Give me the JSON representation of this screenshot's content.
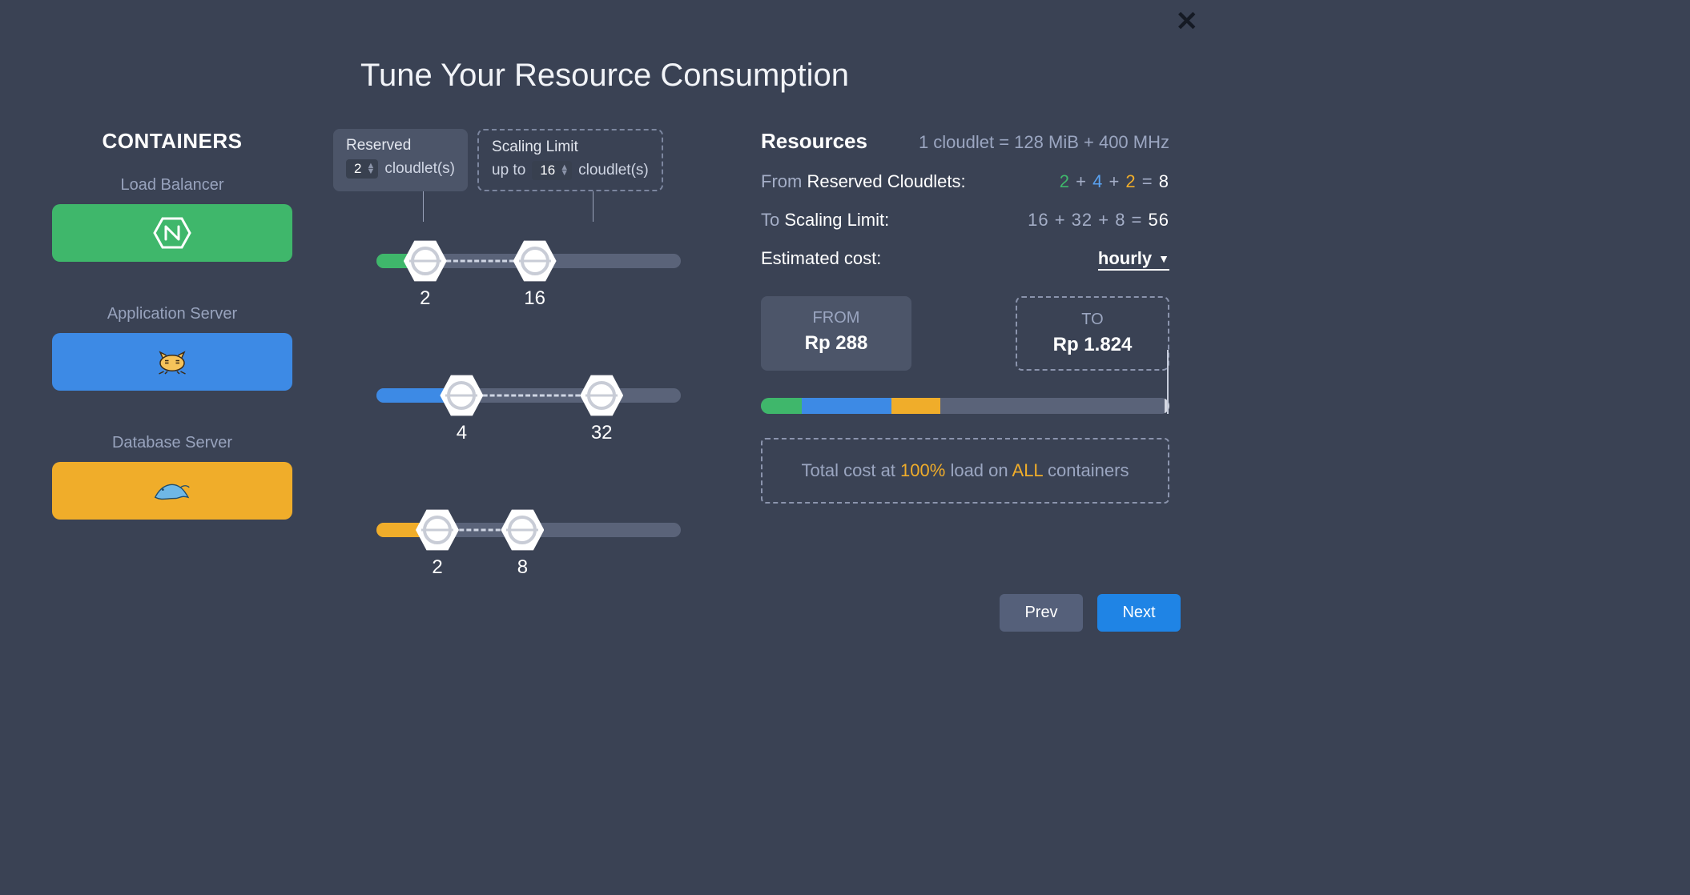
{
  "title": "Tune Your Resource Consumption",
  "close_label": "✕",
  "containers": {
    "heading": "CONTAINERS",
    "items": [
      {
        "label": "Load Balancer",
        "icon": "nginx-icon",
        "color": "green"
      },
      {
        "label": "Application Server",
        "icon": "tomcat-icon",
        "color": "blue"
      },
      {
        "label": "Database Server",
        "icon": "mysql-icon",
        "color": "orange"
      }
    ]
  },
  "tooltips": {
    "reserved": {
      "title": "Reserved",
      "value": "2",
      "unit": "cloudlet(s)"
    },
    "scaling": {
      "title": "Scaling Limit",
      "prefix": "up to",
      "value": "16",
      "unit": "cloudlet(s)"
    }
  },
  "sliders": [
    {
      "reserved": 2,
      "limit": 16,
      "reserved_pct": 16,
      "limit_pct": 52,
      "color": "#3fb76b"
    },
    {
      "reserved": 4,
      "limit": 32,
      "reserved_pct": 28,
      "limit_pct": 74,
      "color": "#3d8ae5"
    },
    {
      "reserved": 2,
      "limit": 8,
      "reserved_pct": 20,
      "limit_pct": 48,
      "color": "#f0ad2a"
    }
  ],
  "resources": {
    "heading": "Resources",
    "cloudlet_def": "1 cloudlet = 128 MiB + 400 MHz",
    "from_label_prefix": "From",
    "from_label_rest": "Reserved Cloudlets:",
    "from_parts": {
      "g": "2",
      "b": "4",
      "o": "2",
      "sum": "8"
    },
    "to_label_prefix": "To",
    "to_label_rest": "Scaling Limit:",
    "to_eq": "16 + 32 + 8 = ",
    "to_sum": "56",
    "est_label": "Estimated cost:",
    "period": "hourly",
    "from_card": {
      "title": "FROM",
      "value": "Rp 288"
    },
    "to_card": {
      "title": "TO",
      "value": "Rp 1.824"
    },
    "bar_segments": {
      "g": 10,
      "b": 22,
      "o": 12
    },
    "total_tpl": {
      "pre": "Total cost at ",
      "pct": "100%",
      "mid": " load on ",
      "all": "ALL",
      "post": " containers"
    }
  },
  "buttons": {
    "prev": "Prev",
    "next": "Next"
  }
}
